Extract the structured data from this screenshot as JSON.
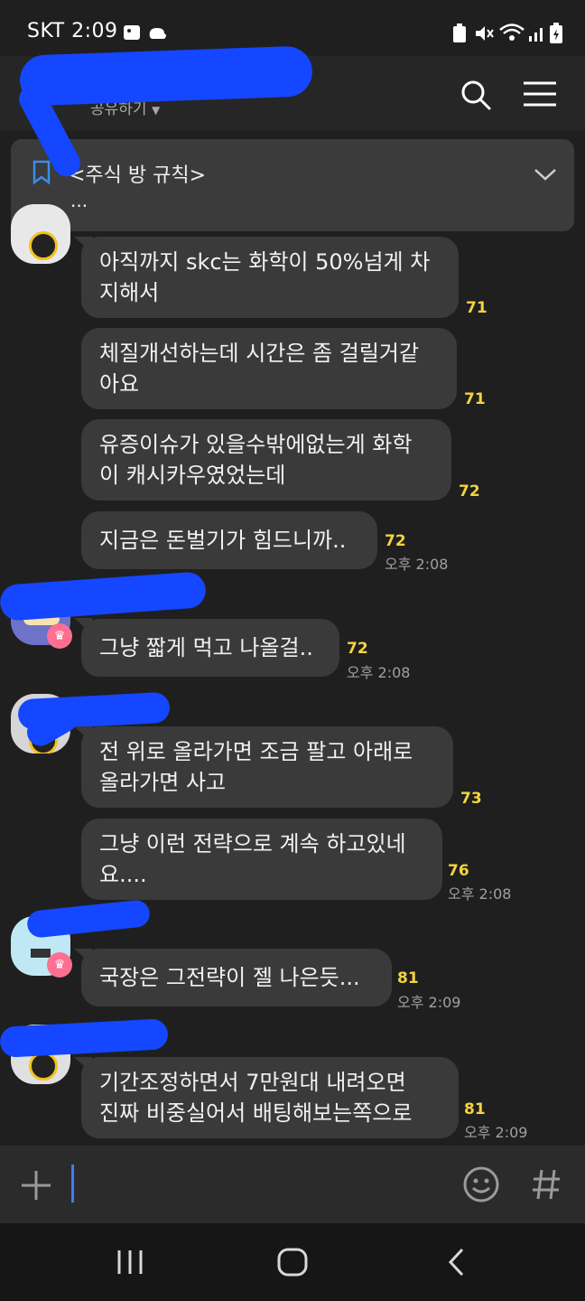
{
  "status_bar": {
    "carrier_time": "SKT 2:09"
  },
  "header": {
    "title": "",
    "share_label": "공유하기"
  },
  "notice": {
    "title": "<주식 방 규칙>",
    "preview": "..."
  },
  "messages": [
    {
      "text": "아직까지 skc는 화학이 50%넘게 차\n지해서",
      "count": "71",
      "time": ""
    },
    {
      "text": "체질개선하는데 시간은 좀 걸릴거같\n아요",
      "count": "71",
      "time": ""
    },
    {
      "text": "유증이슈가 있을수밖에없는게 화학\n이 캐시카우였었는데",
      "count": "72",
      "time": ""
    },
    {
      "text": "지금은 돈벌기가 힘드니까..",
      "count": "72",
      "time": "오후 2:08"
    },
    {
      "text": "그냥 짧게 먹고 나올걸..",
      "count": "72",
      "time": "오후 2:08"
    },
    {
      "text": "전 위로 올라가면 조금 팔고 아래로\n올라가면 사고",
      "count": "73",
      "time": ""
    },
    {
      "text": "그냥 이런 전략으로 계속 하고있네\n요....",
      "count": "76",
      "time": "오후 2:08"
    },
    {
      "text": "국장은 그전략이 젤 나은듯...",
      "count": "81",
      "time": "오후 2:09"
    },
    {
      "text": "기간조정하면서 7만원대 내려오면\n진짜 비중실어서 배팅해보는쪽으로",
      "count": "81",
      "time": "오후 2:09"
    }
  ],
  "input": {
    "value": ""
  },
  "icons": [
    "search-icon",
    "menu-icon",
    "chevron-down-icon",
    "bookmark-icon",
    "plus-icon",
    "emoji-icon",
    "hash-icon",
    "recent-apps-icon",
    "home-icon",
    "back-icon"
  ],
  "colors": {
    "background": "#1f1f1f",
    "bubble": "#3a3a3a",
    "unread_count": "#f5d33f",
    "redaction": "#1447ff",
    "crown_badge": "#ff6f91"
  }
}
